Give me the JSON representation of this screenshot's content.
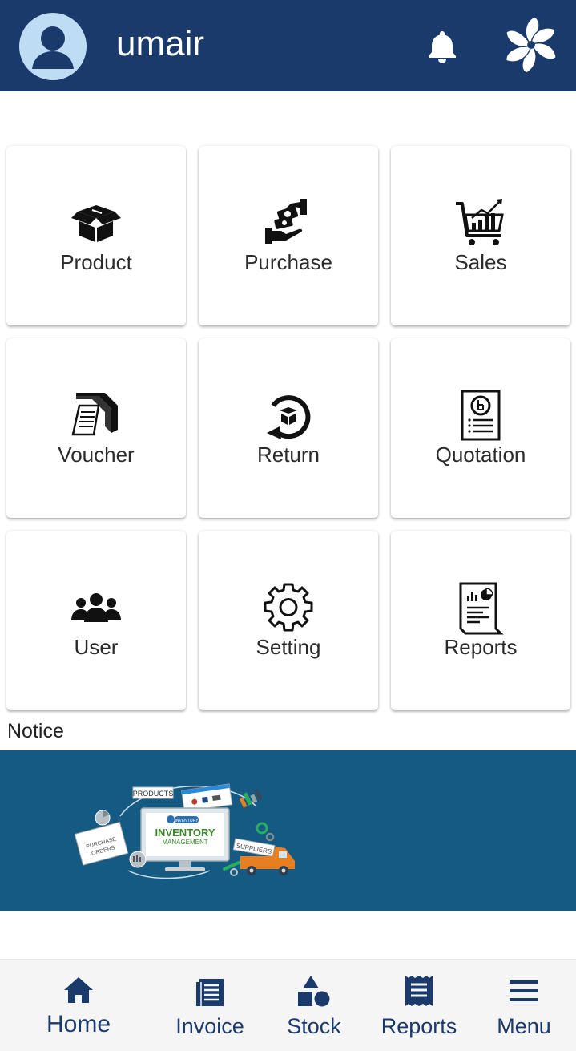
{
  "header": {
    "username": "umair",
    "background": "#1a3a6b",
    "icons": [
      "user-avatar-icon",
      "bell-icon",
      "app-logo-icon"
    ]
  },
  "grid": {
    "tiles": [
      {
        "label": "Product",
        "icon": "product-box-icon"
      },
      {
        "label": "Purchase",
        "icon": "purchase-hand-money-icon"
      },
      {
        "label": "Sales",
        "icon": "sales-cart-chart-icon"
      },
      {
        "label": "Voucher",
        "icon": "voucher-printer-icon"
      },
      {
        "label": "Return",
        "icon": "return-circular-arrow-icon"
      },
      {
        "label": "Quotation",
        "icon": "quotation-document-icon"
      },
      {
        "label": "User",
        "icon": "users-group-icon"
      },
      {
        "label": "Setting",
        "icon": "gear-icon"
      },
      {
        "label": "Reports",
        "icon": "report-document-icon"
      }
    ]
  },
  "notice": {
    "label": "Notice",
    "banner": {
      "background": "#155a82",
      "text_products": "PRODUCTS",
      "text_inventory": "INVENTORY",
      "text_management": "MANAGEMENT",
      "text_suppliers": "SUPPLIERS",
      "text_purchase": "PURCHASE",
      "text_orders": "ORDERS",
      "text_logo": "INVENTORY"
    }
  },
  "bottom_nav": {
    "items": [
      {
        "label": "Home",
        "icon": "home-icon",
        "active": true
      },
      {
        "label": "Invoice",
        "icon": "invoice-icon"
      },
      {
        "label": "Stock",
        "icon": "stock-shapes-icon"
      },
      {
        "label": "Reports",
        "icon": "reports-receipt-icon"
      },
      {
        "label": "Menu",
        "icon": "hamburger-menu-icon"
      }
    ],
    "accent": "#1a3a6b"
  }
}
